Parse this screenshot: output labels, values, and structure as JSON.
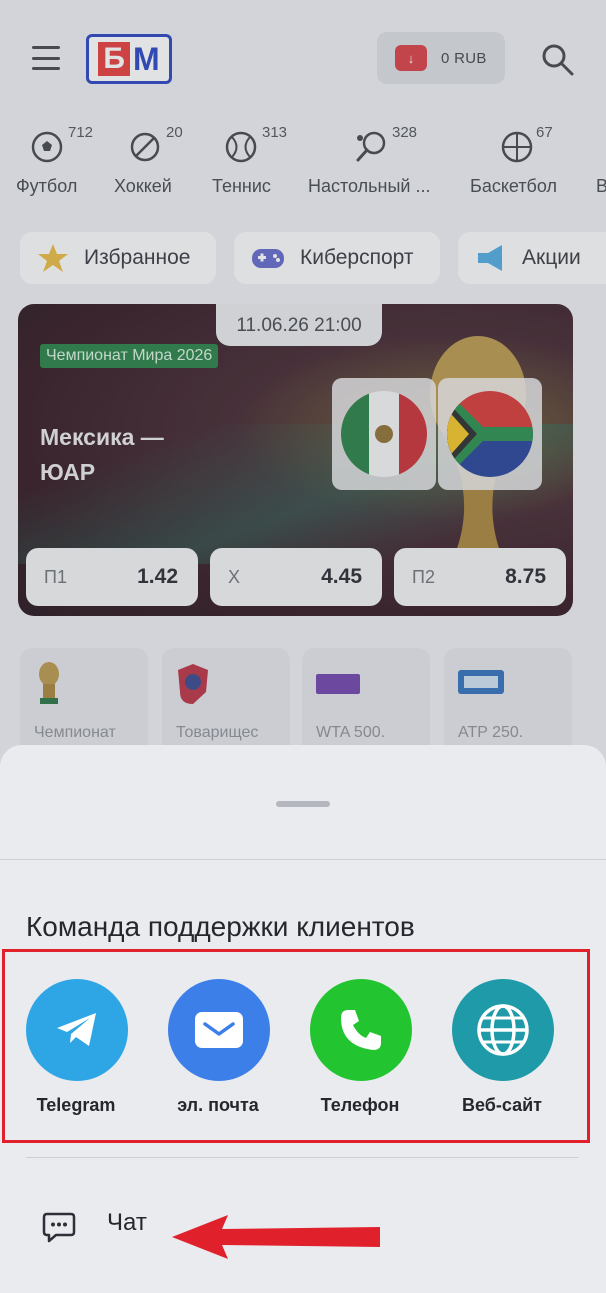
{
  "header": {
    "logo_text_1": "Б",
    "logo_text_2": "М",
    "balance": "0 RUB"
  },
  "sports": [
    {
      "name": "Футбол",
      "count": "712"
    },
    {
      "name": "Хоккей",
      "count": "20"
    },
    {
      "name": "Теннис",
      "count": "313"
    },
    {
      "name": "Настольный ...",
      "count": "328"
    },
    {
      "name": "Баскетбол",
      "count": "67"
    },
    {
      "name": "В",
      "count": ""
    }
  ],
  "chips": [
    {
      "label": "Избранное"
    },
    {
      "label": "Киберспорт"
    },
    {
      "label": "Акции"
    }
  ],
  "event": {
    "datetime": "11.06.26 21:00",
    "league": "Чемпионат Мира 2026",
    "teams_line1": "Мексика —",
    "teams_line2": "ЮАР",
    "odds": [
      {
        "label": "П1",
        "value": "1.42"
      },
      {
        "label": "Х",
        "value": "4.45"
      },
      {
        "label": "П2",
        "value": "8.75"
      }
    ]
  },
  "tournaments": [
    {
      "name": "Чемпионат"
    },
    {
      "name": "Товарищес"
    },
    {
      "name": "WTA 500."
    },
    {
      "name": "ATP 250."
    }
  ],
  "sheet": {
    "title": "Команда поддержки клиентов",
    "contacts": [
      {
        "label": "Telegram",
        "icon": "telegram-icon",
        "color": "#2ea6e6"
      },
      {
        "label": "эл. почта",
        "icon": "mail-icon",
        "color": "#3d7fe8"
      },
      {
        "label": "Телефон",
        "icon": "phone-icon",
        "color": "#22c52f"
      },
      {
        "label": "Веб-сайт",
        "icon": "globe-icon",
        "color": "#1f9aa8"
      }
    ],
    "chat_label": "Чат"
  },
  "colors": {
    "highlight": "#e0202b",
    "accent_red": "#d9363e",
    "brand_blue": "#1e3bbf"
  }
}
